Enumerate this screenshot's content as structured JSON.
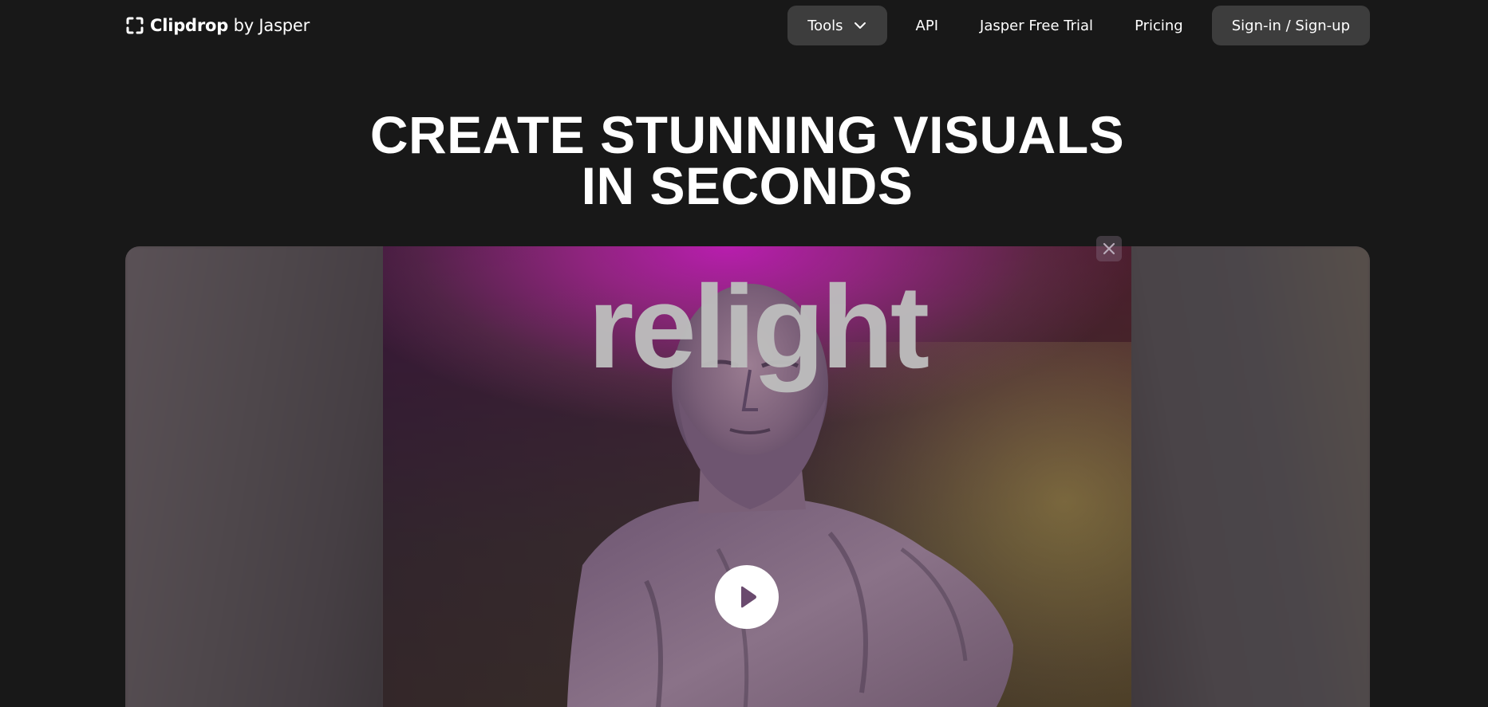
{
  "header": {
    "logo": {
      "brand": "Clipdrop",
      "suffix": " by Jasper",
      "icon": "clipdrop-bracket-icon"
    },
    "nav": {
      "tools_label": "Tools",
      "tools_icon": "chevron-down-icon",
      "api_label": "API",
      "trial_label": "Jasper Free Trial",
      "pricing_label": "Pricing",
      "signin_label": "Sign-in / Sign-up"
    }
  },
  "hero": {
    "title_line1": "CREATE STUNNING VISUALS",
    "title_line2": "IN SECONDS"
  },
  "video": {
    "overlay_text": "relight",
    "close_icon": "close-icon",
    "play_icon": "play-icon"
  },
  "colors": {
    "background": "#181818",
    "button_bg": "#3d3d3d",
    "text": "#ffffff",
    "magenta_light": "#be1eb4"
  }
}
